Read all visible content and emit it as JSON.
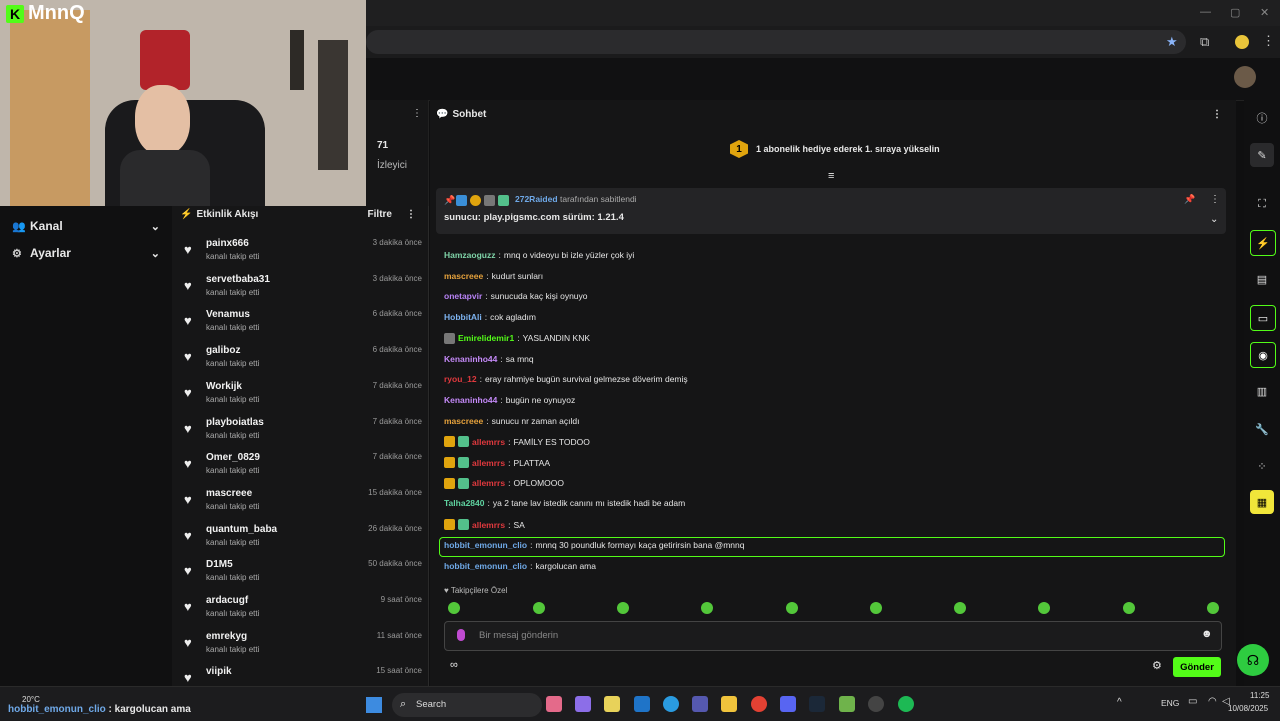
{
  "channel_logo": "MnnQ",
  "browser": {
    "icons": [
      "star-icon",
      "extensions-icon",
      "profile-icon",
      "menu-icon"
    ],
    "window_controls": [
      "—",
      "▢",
      "✕"
    ]
  },
  "viewer": {
    "count": "71",
    "label": "İzleyici"
  },
  "sidebar": {
    "items": [
      {
        "label": "Kanal"
      },
      {
        "label": "Ayarlar"
      }
    ]
  },
  "feed": {
    "title": "Etkinlik Akışı",
    "filter": "Filtre",
    "items": [
      {
        "name": "painx666",
        "action": "kanalı takip etti",
        "time": "3 dakika önce"
      },
      {
        "name": "servetbaba31",
        "action": "kanalı takip etti",
        "time": "3 dakika önce"
      },
      {
        "name": "Venamus",
        "action": "kanalı takip etti",
        "time": "6 dakika önce"
      },
      {
        "name": "galiboz",
        "action": "kanalı takip etti",
        "time": "6 dakika önce"
      },
      {
        "name": "Workijk",
        "action": "kanalı takip etti",
        "time": "7 dakika önce"
      },
      {
        "name": "playboiatlas",
        "action": "kanalı takip etti",
        "time": "7 dakika önce"
      },
      {
        "name": "Omer_0829",
        "action": "kanalı takip etti",
        "time": "7 dakika önce"
      },
      {
        "name": "mascreee",
        "action": "kanalı takip etti",
        "time": "15 dakika önce"
      },
      {
        "name": "quantum_baba",
        "action": "kanalı takip etti",
        "time": "26 dakika önce"
      },
      {
        "name": "D1M5",
        "action": "kanalı takip etti",
        "time": "50 dakika önce"
      },
      {
        "name": "ardacugf",
        "action": "kanalı takip etti",
        "time": "9 saat önce"
      },
      {
        "name": "emrekyg",
        "action": "kanalı takip etti",
        "time": "11 saat önce"
      },
      {
        "name": "viipik",
        "action": "",
        "time": "15 saat önce"
      }
    ]
  },
  "chat": {
    "title": "Sohbet",
    "gift_rank": "1",
    "gift_banner": "1 abonelik hediye ederek 1. sıraya yükselin",
    "pinned": {
      "by_user": "272Raided",
      "by_text": "tarafından sabitlendi",
      "message": "sunucu: play.pigsmc.com sürüm: 1.21.4"
    },
    "messages": [
      {
        "user": "Hamzaoguzz",
        "text": "mnq o videoyu bi izle yüzler çok iyi",
        "color": "#7fd3a8",
        "badges": []
      },
      {
        "user": "mascreee",
        "text": "kudurt sunları",
        "color": "#e6a23c",
        "badges": []
      },
      {
        "user": "onetapvir",
        "text": "sunucuda kaç kişi oynuyo",
        "color": "#b782f5",
        "badges": []
      },
      {
        "user": "HobbitAli",
        "text": "cok agladım",
        "color": "#7db3f0",
        "badges": []
      },
      {
        "user": "Emirelidemir1",
        "text": "YASLANDIN KNK",
        "color": "#53fc18",
        "badges": [
          "mod"
        ]
      },
      {
        "user": "Kenaninho44",
        "text": "sa mnq",
        "color": "#c58af9",
        "badges": []
      },
      {
        "user": "ryou_12",
        "text": "eray rahmiye bugün survival gelmezse döverim demiş",
        "color": "#e0393e",
        "badges": []
      },
      {
        "user": "Kenaninho44",
        "text": "bugün ne oynuyoz",
        "color": "#c58af9",
        "badges": []
      },
      {
        "user": "mascreee",
        "text": "sunucu nr zaman açıldı",
        "color": "#e6a23c",
        "badges": []
      },
      {
        "user": "allemrrs",
        "text": "FAMİLY ES TODOO",
        "color": "#e0393e",
        "badges": [
          "crown",
          "sub"
        ]
      },
      {
        "user": "allemrrs",
        "text": "PLATTAA",
        "color": "#e0393e",
        "badges": [
          "crown",
          "sub"
        ]
      },
      {
        "user": "allemrrs",
        "text": "OPLOMOOO",
        "color": "#e0393e",
        "badges": [
          "crown",
          "sub"
        ]
      },
      {
        "user": "Talha2840",
        "text": "ya 2 tane lav istedik canını mı istedik hadi be adam",
        "color": "#5fd3a0",
        "badges": []
      },
      {
        "user": "allemrrs",
        "text": "SA",
        "color": "#e0393e",
        "badges": [
          "crown",
          "sub"
        ]
      },
      {
        "user": "hobbit_emonun_clio",
        "text": "mnnq 30 poundluk formayı kaça getirirsin bana @mnnq",
        "color": "#6fa9e8",
        "badges": [],
        "highlight": true
      },
      {
        "user": "hobbit_emonun_clio",
        "text": "kargolucan ama",
        "color": "#6fa9e8",
        "badges": []
      }
    ],
    "followers_only": "Takipçilere Özel",
    "input_placeholder": "Bir mesaj gönderin",
    "send_label": "Gönder",
    "accent_color": "#53fc18"
  },
  "right_rail": [
    "info-icon",
    "pencil-icon",
    "crop-icon",
    "bolt-icon",
    "document-icon",
    "chat-icon",
    "broadcast-icon",
    "layers-icon",
    "wrench-icon",
    "share-icon",
    "clapper-icon"
  ],
  "taskbar": {
    "notification": {
      "user": "hobbit_emonun_clio",
      "text": "kargolucan ama",
      "temperature": "20°C"
    },
    "search_label": "Search",
    "language": "ENG",
    "time": "11:25",
    "date": "10/08/2025"
  }
}
